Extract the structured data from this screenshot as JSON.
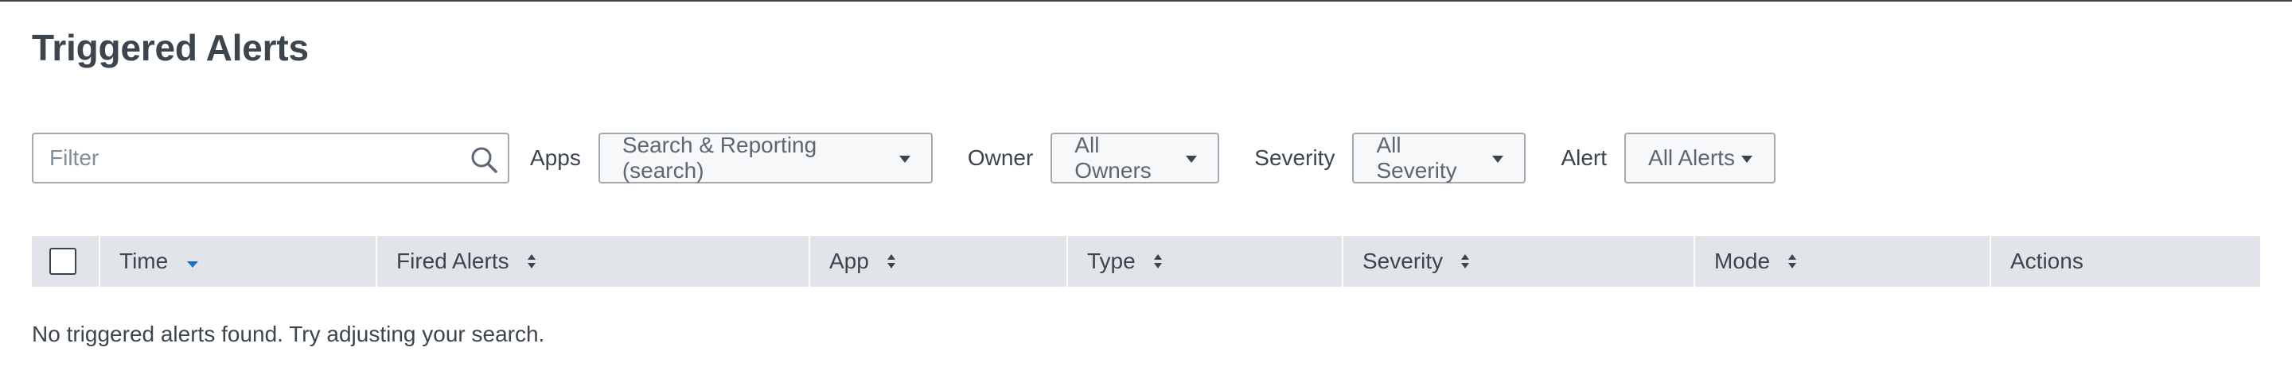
{
  "page": {
    "title": "Triggered Alerts"
  },
  "filters": {
    "filter_placeholder": "Filter",
    "apps_label": "Apps",
    "apps_value": "Search & Reporting (search)",
    "owner_label": "Owner",
    "owner_value": "All Owners",
    "severity_label": "Severity",
    "severity_value": "All Severity",
    "alert_label": "Alert",
    "alert_value": "All Alerts"
  },
  "table": {
    "columns": [
      {
        "label": "Time",
        "sort": "descending"
      },
      {
        "label": "Fired Alerts",
        "sort": "none"
      },
      {
        "label": "App",
        "sort": "none"
      },
      {
        "label": "Type",
        "sort": "none"
      },
      {
        "label": "Severity",
        "sort": "none"
      },
      {
        "label": "Mode",
        "sort": "none"
      },
      {
        "label": "Actions",
        "sort": "not-sortable"
      }
    ],
    "empty_message": "No triggered alerts found. Try adjusting your search."
  },
  "colors": {
    "text": "#3c444d",
    "header_bg": "#e1e5e9",
    "sort_active": "#1a73c6",
    "dropdown_bg": "#f7f8fa",
    "border": "#a3aab1"
  },
  "icons": {
    "search": "search-icon",
    "caret": "caret-down-icon",
    "sort": "sort-icon",
    "sort_desc": "sort-descending-icon"
  }
}
